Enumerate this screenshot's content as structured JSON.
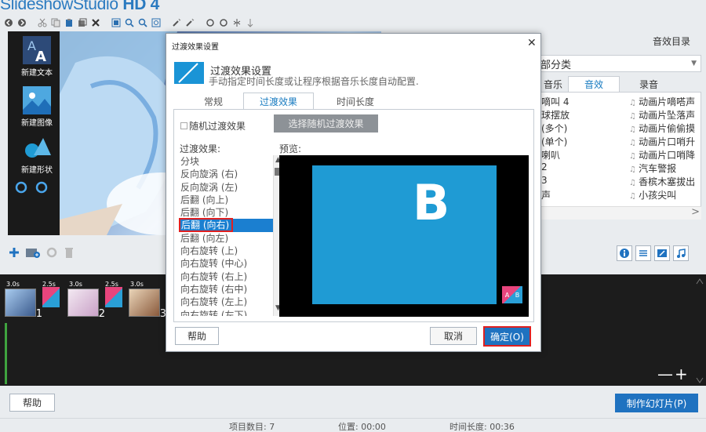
{
  "app": {
    "title_part1": "Slideshow",
    "title_part2": "Studio",
    "title_part3": "HD 4"
  },
  "left_tools": {
    "new_text": "新建文本",
    "new_image": "新建图像",
    "new_shape": "新建形状"
  },
  "sfx_panel": {
    "title": "音效目录",
    "category_value": "部分类",
    "tabs": [
      "音乐",
      "音效",
      "录音"
    ],
    "left_items": [
      "嘀叫 4",
      "球摆放",
      "(多个)",
      "(单个)",
      "喇叭",
      "2",
      "3",
      "声"
    ],
    "right_items": [
      "动画片嘀嗒声",
      "动画片坠落声",
      "动画片偷偷摸",
      "动画片口哨升",
      "动画片口哨降",
      "汽车警报",
      "香槟木塞拔出",
      "小孩尖叫"
    ]
  },
  "timeline": {
    "clips": [
      {
        "duration": "3.0s",
        "number": "1"
      },
      {
        "duration": "3.0s",
        "number": "2"
      },
      {
        "duration": "3.0s",
        "number": "3"
      }
    ],
    "transitions": [
      {
        "duration": "2.5s"
      },
      {
        "duration": "2.5s"
      }
    ],
    "zoom": "—+"
  },
  "bottom": {
    "help": "帮助",
    "make": "制作幻灯片(P)"
  },
  "status": {
    "items": "项目数目: 7",
    "position": "位置: 00:00",
    "length": "时间长度: 00:36"
  },
  "dialog": {
    "title": "过渡效果设置",
    "header_title": "过渡效果设置",
    "header_subtitle": "手动指定时间长度或让程序根据音乐长度自动配置.",
    "tabs": [
      "常规",
      "过渡效果",
      "时间长度"
    ],
    "active_tab": 1,
    "random_checkbox": "随机过渡效果",
    "random_button": "选择随机过渡效果",
    "effects_label": "过渡效果:",
    "preview_label": "预览:",
    "effects": [
      "分块",
      "反向旋涡 (右)",
      "反向旋涡 (左)",
      "后翻 (向上)",
      "后翻 (向下)",
      "后翻 (向右)",
      "后翻 (向左)",
      "向右旋转 (上)",
      "向右旋转 (中心)",
      "向右旋转 (右上)",
      "向右旋转 (右中)",
      "向右旋转 (左上)",
      "向右旋转 (左下)"
    ],
    "selected_effect": 5,
    "preview_letter": "B",
    "preview_badge_a": "A",
    "preview_badge_b": "B",
    "help": "帮助",
    "cancel": "取消",
    "ok": "确定(O)"
  },
  "colors": {
    "accent": "#1f72c0",
    "highlight": "#e02020",
    "preview_blue": "#1f9bd4"
  }
}
